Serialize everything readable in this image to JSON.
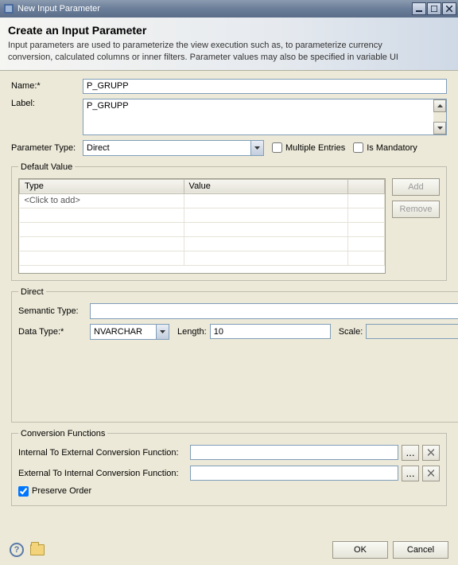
{
  "window": {
    "title": "New Input Parameter"
  },
  "banner": {
    "heading": "Create an Input Parameter",
    "description": "Input parameters are used to parameterize the view execution such as, to parameterize currency conversion, calculated columns or inner filters. Parameter values may also be specified in variable UI"
  },
  "fields": {
    "name_label": "Name:*",
    "name_value": "P_GRUPP",
    "label_label": "Label:",
    "label_value": "P_GRUPP",
    "param_type_label": "Parameter Type:",
    "param_type_value": "Direct",
    "multiple_entries_label": "Multiple Entries",
    "is_mandatory_label": "Is Mandatory"
  },
  "default_value": {
    "legend": "Default Value",
    "col_type": "Type",
    "col_value": "Value",
    "placeholder_row": "<Click to add>",
    "add_label": "Add",
    "remove_label": "Remove"
  },
  "direct": {
    "legend": "Direct",
    "semantic_type_label": "Semantic Type:",
    "semantic_type_value": "",
    "data_type_label": "Data Type:*",
    "data_type_value": "NVARCHAR",
    "length_label": "Length:",
    "length_value": "10",
    "scale_label": "Scale:",
    "scale_value": ""
  },
  "conversion": {
    "legend": "Conversion Functions",
    "int_to_ext_label": "Internal To External Conversion Function:",
    "int_to_ext_value": "",
    "ext_to_int_label": "External To Internal Conversion Function:",
    "ext_to_int_value": "",
    "preserve_order_label": "Preserve Order",
    "preserve_order_checked": true,
    "browse_label": "..."
  },
  "footer": {
    "ok_label": "OK",
    "cancel_label": "Cancel"
  }
}
